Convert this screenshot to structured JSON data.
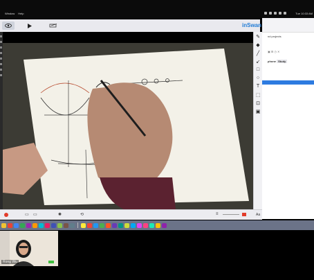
{
  "menubar": {
    "menu_items": [
      "",
      "Window",
      "Help"
    ],
    "clock": "Tue 10:33 AM"
  },
  "toolbar": {
    "brand": "inSwan",
    "eye_icon": "eye-icon",
    "play_icon": "play-icon",
    "edit_icon": "pencil-edit-icon"
  },
  "side_panel": {
    "heading": "nd projects",
    "item": "phone",
    "item_tag": "Study"
  },
  "bottom_controls": {
    "zoom_label": "Aa"
  },
  "dock_colors": [
    "#f1c232",
    "#ea4335",
    "#4285f4",
    "#34a853",
    "#9c27b0",
    "#ff9800",
    "#00bcd4",
    "#e91e63",
    "#3f51b5",
    "#8bc34a",
    "#795548",
    "#607d8b",
    "#ffeb3b",
    "#f44336",
    "#2196f3",
    "#4caf50",
    "#ff5722",
    "#673ab7",
    "#009688",
    "#cddc39",
    "#03a9f4",
    "#e040fb",
    "#ff4081",
    "#1de9b6",
    "#ffc107",
    "#8e24aa"
  ],
  "participant": {
    "name": "Rong Wu"
  }
}
